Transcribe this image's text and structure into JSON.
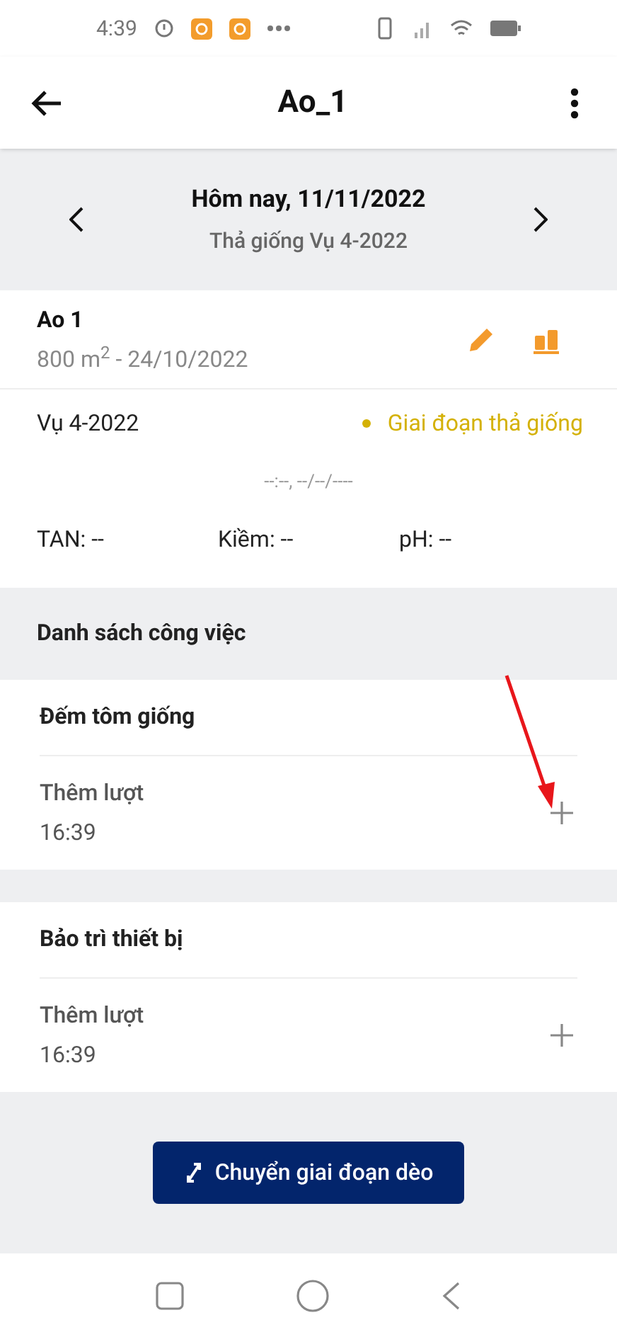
{
  "status_bar": {
    "time": "4:39"
  },
  "app_bar": {
    "title": "Ao_1"
  },
  "date_nav": {
    "date": "Hôm nay, 11/11/2022",
    "subtitle": "Thả giống Vụ 4-2022"
  },
  "pond": {
    "name": "Ao 1",
    "info": "800 m$^{2}$ - 24/10/2022",
    "season": "Vụ 4-2022",
    "stage": {
      "label": "Giai đoạn thả giống",
      "color": "#d4b106"
    },
    "measured_at": "--:--, --/--/----",
    "readings": [
      {
        "label": "TAN: --"
      },
      {
        "label": "Kiềm: --"
      },
      {
        "label": "pH: --"
      }
    ]
  },
  "task_list": {
    "title": "Danh sách công việc",
    "tasks": [
      {
        "title": "Đếm tôm giống",
        "action": "Thêm lượt",
        "time": "16:39"
      },
      {
        "title": "Bảo trì thiết bị",
        "action": "Thêm lượt",
        "time": "16:39"
      }
    ]
  },
  "annotations": [
    {
      "kind": "arrow"
    }
  ],
  "primary_button": {
    "label": "Chuyển giai đoạn dèo"
  }
}
